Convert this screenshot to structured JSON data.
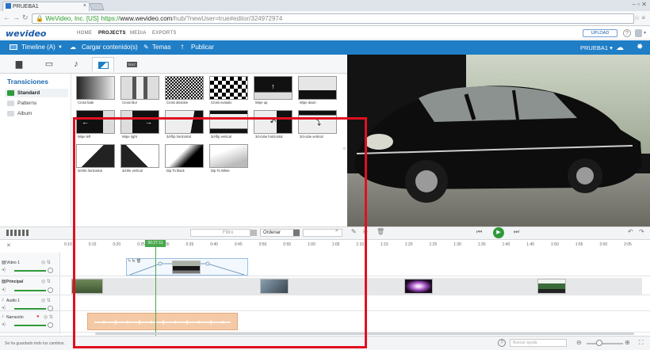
{
  "browser": {
    "tab_title": "PRUEBA1",
    "tab_close": "×",
    "url_org": "WeVideo, Inc. [US]",
    "url_scheme": "https://",
    "url_host": "www.wevideo.com",
    "url_path": "/hub/?newUser=true#editor/324972974"
  },
  "app": {
    "logo": "wevideo",
    "nav": [
      "HOME",
      "PROJECTS",
      "MEDIA",
      "EXPORTS"
    ],
    "upload_label": "UPLOAD",
    "help_label": "?"
  },
  "toolbar": {
    "timeline_label": "Timeline (A)",
    "upload_content": "Cargar contenido(s)",
    "themes": "Temas",
    "publish": "Publicar",
    "project_name": "PRUEBA1 ▾"
  },
  "library": {
    "text_tab": "TEXT",
    "sidebar_title": "Transiciones",
    "categories": [
      "Standard",
      "Patterns",
      "Album"
    ],
    "transitions": [
      "Cross fade",
      "Cross blur",
      "Cross dissolve",
      "Cross evalutiv",
      "Wipe up",
      "Wipe down",
      "Wipe left",
      "Wipe right",
      "3d-flip horizontal",
      "3d-flip vertical",
      "3d-cube horizontal",
      "3d-cube vertical",
      "3d-tile horizontal",
      "3d-tile vertical",
      "Dip To black",
      "Dip To White"
    ]
  },
  "controls": {
    "filter_placeholder": "Filtro",
    "sort_label": "Ordenar"
  },
  "timeline": {
    "ticks": [
      "0:10",
      "0:15",
      "0:20",
      "0:25",
      "0:30",
      "0:35",
      "0:40",
      "0:45",
      "0:50",
      "0:55",
      "1:00",
      "1:05",
      "1:10",
      "1:15",
      "1:20",
      "1:25",
      "1:30",
      "1:35",
      "1:40",
      "1:45",
      "1:50",
      "1:55",
      "2:00",
      "2:05"
    ],
    "playhead_time": "00:27:11",
    "tracks": [
      "Video 1",
      "Principal",
      "Audio 1",
      "Narración"
    ]
  },
  "status": {
    "saved_text": "Se ha guardado todo los cambios.",
    "help_search_placeholder": "Buscar ayuda"
  },
  "colors": {
    "accent": "#1f7ec6",
    "green": "#2f9a3a",
    "highlight_box": "#e01020"
  }
}
